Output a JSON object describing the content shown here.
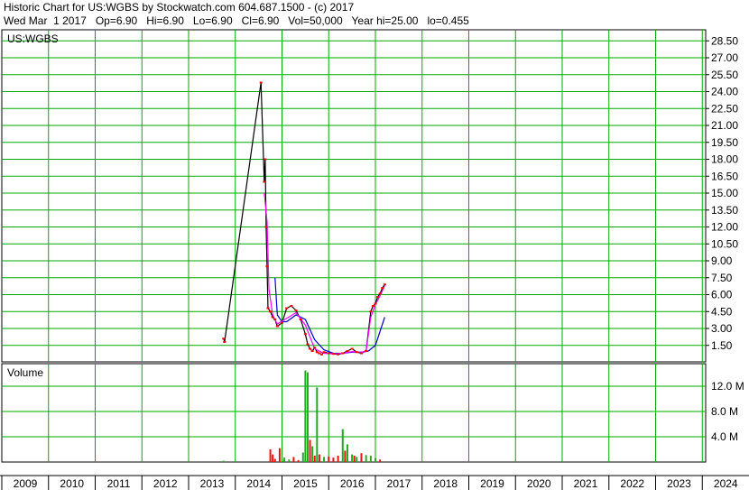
{
  "header": {
    "line1": "Historic Chart for US:WGBS by Stockwatch.com 604.687.1500 - (c) 2017",
    "line2": "Wed Mar  1 2017   Op=6.90   Hi=6.90   Lo=6.90   Cl=6.90   Vol=50,000   Year hi=25.00   lo=0.455"
  },
  "colors": {
    "grid": "#00aa00",
    "price": "#000000",
    "price_marker": "#ff0000",
    "ma_short": "#ff00ff",
    "ma_long": "#0000cc",
    "volume_up": "#22aa22",
    "volume_down": "#ee1111"
  },
  "chart_data": [
    {
      "type": "line",
      "title": "US:WGBS",
      "ylim": [
        0,
        29.5
      ],
      "y_ticks": [
        "1.50",
        "3.00",
        "4.50",
        "6.00",
        "7.50",
        "9.00",
        "10.50",
        "12.00",
        "13.50",
        "15.00",
        "16.50",
        "18.00",
        "19.50",
        "21.00",
        "22.50",
        "24.00",
        "25.50",
        "27.00",
        "28.50"
      ],
      "x_ticks": [
        "2009",
        "2010",
        "2011",
        "2012",
        "2013",
        "2014",
        "2015",
        "2016",
        "2017",
        "2018",
        "2019",
        "2020",
        "2021",
        "2022",
        "2023",
        "2024"
      ],
      "series": [
        {
          "role": "price",
          "x": [
            2013.25,
            2013.27,
            2014.05,
            2014.12,
            2014.14,
            2014.16,
            2014.18,
            2014.2,
            2014.25,
            2014.3,
            2014.35,
            2014.4,
            2014.5,
            2014.6,
            2014.7,
            2014.8,
            2014.9,
            2015.0,
            2015.05,
            2015.1,
            2015.15,
            2015.2,
            2015.25,
            2015.3,
            2015.35,
            2015.4,
            2015.5,
            2015.6,
            2015.7,
            2015.8,
            2015.9,
            2016.0,
            2016.1,
            2016.2,
            2016.3,
            2016.4,
            2016.45,
            2016.5,
            2016.55,
            2016.6,
            2016.65,
            2016.7
          ],
          "values": [
            2.1,
            1.8,
            24.8,
            16.0,
            18.0,
            12.0,
            8.5,
            4.8,
            4.5,
            4.0,
            3.8,
            3.2,
            3.5,
            4.8,
            5.0,
            4.6,
            3.8,
            2.5,
            1.6,
            1.2,
            1.0,
            1.3,
            0.9,
            0.8,
            0.7,
            0.9,
            0.8,
            0.75,
            0.7,
            0.8,
            1.0,
            1.2,
            0.9,
            0.8,
            1.0,
            4.5,
            5.0,
            5.2,
            5.8,
            6.1,
            6.6,
            6.9
          ]
        },
        {
          "role": "ma_short",
          "x": [
            2014.12,
            2014.18,
            2014.22,
            2014.3,
            2014.4,
            2014.6,
            2014.8,
            2015.0,
            2015.2,
            2015.4,
            2015.6,
            2015.8,
            2016.0,
            2016.2,
            2016.3,
            2016.4,
            2016.5,
            2016.6,
            2016.7
          ],
          "values": [
            15.0,
            12.5,
            6.5,
            4.2,
            3.4,
            3.9,
            4.4,
            3.3,
            1.2,
            0.8,
            0.75,
            0.8,
            0.95,
            0.9,
            0.95,
            4.0,
            5.1,
            5.9,
            6.8
          ]
        },
        {
          "role": "ma_long",
          "x": [
            2014.35,
            2014.4,
            2014.5,
            2014.6,
            2014.8,
            2015.0,
            2015.2,
            2015.4,
            2015.6,
            2015.8,
            2016.0,
            2016.2,
            2016.35,
            2016.5,
            2016.7
          ],
          "values": [
            7.5,
            4.2,
            3.6,
            3.6,
            4.2,
            3.8,
            2.0,
            1.1,
            0.8,
            0.8,
            0.9,
            0.9,
            1.0,
            1.5,
            4.0
          ]
        }
      ]
    },
    {
      "type": "bar",
      "title": "Volume",
      "ylim": [
        0,
        15000000
      ],
      "y_ticks": [
        "4.0 M",
        "8.0 M",
        "12.0 M"
      ],
      "y_tick_values": [
        4000000,
        8000000,
        12000000
      ],
      "x": [
        2013.25,
        2014.25,
        2014.3,
        2014.35,
        2014.45,
        2014.55,
        2014.65,
        2014.75,
        2014.85,
        2014.95,
        2015.0,
        2015.05,
        2015.1,
        2015.15,
        2015.2,
        2015.25,
        2015.3,
        2015.4,
        2015.5,
        2015.6,
        2015.7,
        2015.8,
        2015.85,
        2015.9,
        2016.0,
        2016.05,
        2016.1,
        2016.2,
        2016.3,
        2016.4,
        2016.5,
        2016.6
      ],
      "values": [
        200000,
        2000000,
        1200000,
        500000,
        2200000,
        700000,
        400000,
        800000,
        300000,
        1500000,
        14500000,
        14200000,
        3500000,
        2500000,
        1000000,
        11800000,
        1200000,
        800000,
        900000,
        700000,
        1000000,
        5200000,
        1800000,
        2800000,
        1200000,
        1000000,
        800000,
        1400000,
        1100000,
        1000000,
        600000,
        400000
      ],
      "direction": [
        "up",
        "down",
        "down",
        "down",
        "down",
        "up",
        "up",
        "down",
        "down",
        "up",
        "up",
        "up",
        "down",
        "up",
        "down",
        "up",
        "down",
        "up",
        "down",
        "down",
        "down",
        "up",
        "down",
        "up",
        "up",
        "down",
        "up",
        "down",
        "up",
        "up",
        "up",
        "down"
      ]
    }
  ]
}
